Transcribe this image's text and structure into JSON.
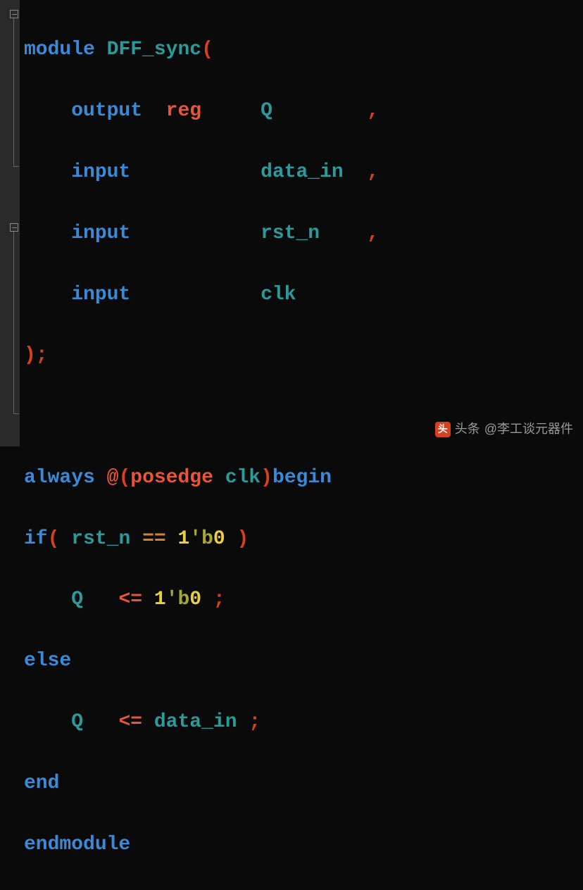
{
  "code": {
    "line1": {
      "kw_module": "module",
      "name": "DFF_sync",
      "paren_open": "("
    },
    "line2": {
      "kw_output": "output",
      "kw_reg": "reg",
      "sig": "Q",
      "comma": ","
    },
    "line3": {
      "kw_input": "input",
      "sig": "data_in",
      "comma": ","
    },
    "line4": {
      "kw_input": "input",
      "sig": "rst_n",
      "comma": ","
    },
    "line5": {
      "kw_input": "input",
      "sig": "clk"
    },
    "line6": {
      "paren_close": ")",
      "semi": ";"
    },
    "line8": {
      "kw_always": "always",
      "at": "@",
      "paren_open": "(",
      "kw_posedge": "posedge",
      "sig": "clk",
      "paren_close": ")",
      "kw_begin": "begin"
    },
    "line9": {
      "kw_if": "if",
      "paren_open": "(",
      "sig": "rst_n",
      "op_eq": "==",
      "lit_width": "1",
      "lit_base": "'b",
      "lit_val": "0",
      "paren_close": ")"
    },
    "line10": {
      "sig": "Q",
      "op_le": "<=",
      "lit_width": "1",
      "lit_base": "'b",
      "lit_val": "0",
      "semi": ";"
    },
    "line11": {
      "kw_else": "else"
    },
    "line12": {
      "sig": "Q",
      "op_le": "<=",
      "sig2": "data_in",
      "semi": ";"
    },
    "line13": {
      "kw_end": "end"
    },
    "line14": {
      "kw_endmodule": "endmodule"
    }
  },
  "watermark": {
    "label": "头条",
    "handle": "@李工谈元器件"
  }
}
